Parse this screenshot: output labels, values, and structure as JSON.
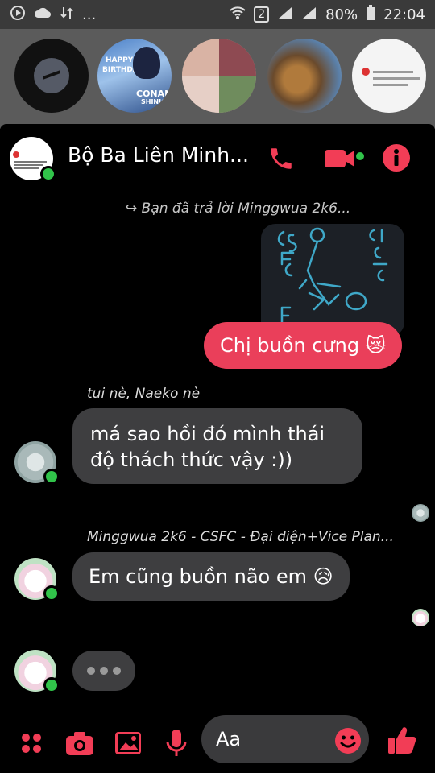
{
  "status_bar": {
    "signal_badge": "2",
    "battery": "80%",
    "time": "22:04",
    "overflow": "..."
  },
  "chat": {
    "title": "Bộ Ba Liên Minh...",
    "reply_note": "Bạn đã trả lời Minggwua 2k6...",
    "outgoing_text": "Chị buồn cưng 😿",
    "messages": [
      {
        "sender": "tui nè, Naeko nè",
        "text_line1": "má sao hồi đó mình thái",
        "text_line2": "độ thách thức vậy :))"
      },
      {
        "sender": "Minggwua 2k6 - CSFC - Đại diện+Vice Plan...",
        "text": "Em cũng buồn não em 😥"
      }
    ],
    "typing_dots": "•••"
  },
  "composer": {
    "placeholder": "Aa"
  },
  "chat_heads": {
    "anime_text1": "HAPPY",
    "anime_text2": "BIRTHDAY",
    "anime_text3": "CONAN",
    "anime_text4": "SHINICHI"
  },
  "colors": {
    "accent": "#f23d56",
    "bubble_me": "#ea3f5a",
    "bubble_them": "#3e3e40",
    "online": "#31c34a"
  },
  "icons": {
    "call": "phone-icon",
    "video": "video-camera-icon",
    "info": "info-icon",
    "apps": "four-dots-icon",
    "camera": "camera-icon",
    "gallery": "image-icon",
    "mic": "microphone-icon",
    "emoji": "emoji-icon",
    "like": "thumbs-up-icon"
  }
}
